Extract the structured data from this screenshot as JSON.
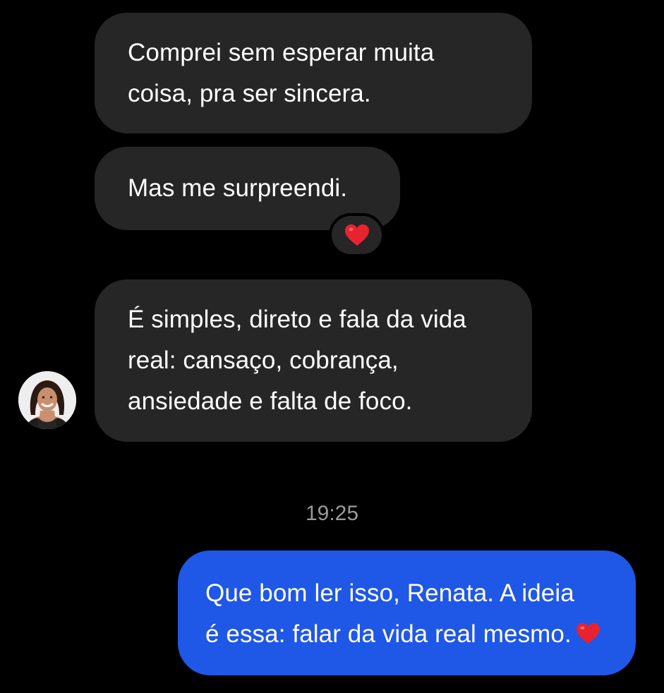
{
  "conversation": {
    "messages": [
      {
        "sender": "contact",
        "lines": [
          "Comprei sem esperar muita",
          "coisa, pra ser sincera."
        ]
      },
      {
        "sender": "contact",
        "lines": [
          "Mas me surpreendi."
        ],
        "reaction": "heart-icon"
      },
      {
        "sender": "contact",
        "lines": [
          "É simples, direto e fala da vida",
          "real: cansaço, cobrança,",
          "ansiedade e falta de foco."
        ]
      },
      {
        "sender": "me",
        "lines": [
          "Que bom ler isso, Renata. A ideia",
          "é essa: falar da vida real mesmo."
        ],
        "trailing_icon": "heart-icon"
      }
    ],
    "timestamp": "19:25"
  },
  "colors": {
    "background": "#000000",
    "incoming_bubble": "#262626",
    "outgoing_bubble": "#1f57e6",
    "timestamp_text": "#9a9a9a",
    "heart": "#e8232f"
  },
  "icons": {
    "reaction": "heart-icon",
    "avatar": "contact-avatar-photo"
  }
}
